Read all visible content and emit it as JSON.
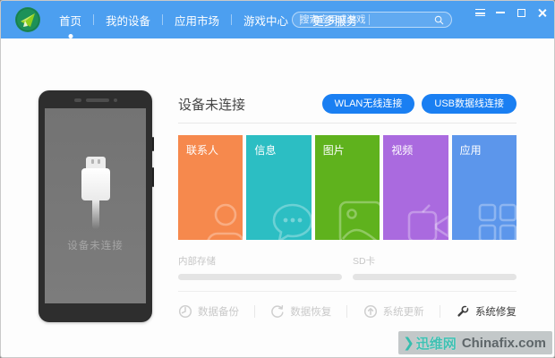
{
  "colors": {
    "navbar": "#4c9ff0",
    "connect_button": "#1a7ff2",
    "logo_circle": "#1d8a55"
  },
  "navbar": {
    "items": [
      {
        "label": "首页",
        "active": true
      },
      {
        "label": "我的设备",
        "active": false
      },
      {
        "label": "应用市场",
        "active": false
      },
      {
        "label": "游戏中心",
        "active": false
      },
      {
        "label": "更多服务",
        "active": false
      }
    ],
    "search_placeholder": "搜索应用或游戏",
    "window_controls": [
      {
        "icon": "menu-icon"
      },
      {
        "icon": "minimize-icon"
      },
      {
        "icon": "maximize-icon"
      },
      {
        "icon": "close-icon"
      }
    ]
  },
  "phone_preview": {
    "status_text": "设备未连接"
  },
  "main": {
    "title": "设备未连接",
    "connect_buttons": [
      {
        "label": "WLAN无线连接"
      },
      {
        "label": "USB数据线连接"
      }
    ],
    "tiles": [
      {
        "label": "联系人",
        "color": "#f6894d",
        "icon": "contacts-person-icon"
      },
      {
        "label": "信息",
        "color": "#2cbec3",
        "icon": "message-bubble-icon"
      },
      {
        "label": "图片",
        "color": "#5fb21d",
        "icon": "picture-icon"
      },
      {
        "label": "视频",
        "color": "#aa6adf",
        "icon": "video-camera-icon"
      },
      {
        "label": "应用",
        "color": "#5c96eb",
        "icon": "apps-grid-icon"
      }
    ],
    "storage": [
      {
        "label": "内部存储"
      },
      {
        "label": "SD卡"
      }
    ],
    "actions": [
      {
        "label": "数据备份",
        "enabled": false,
        "icon": "backup-clock-icon"
      },
      {
        "label": "数据恢复",
        "enabled": false,
        "icon": "restore-arrow-icon"
      },
      {
        "label": "系统更新",
        "enabled": false,
        "icon": "update-arrow-icon"
      },
      {
        "label": "系统修复",
        "enabled": true,
        "icon": "repair-wrench-icon"
      }
    ]
  },
  "watermark": {
    "arrow": "❯",
    "site": "迅维网",
    "domain": "Chinafix.com"
  }
}
